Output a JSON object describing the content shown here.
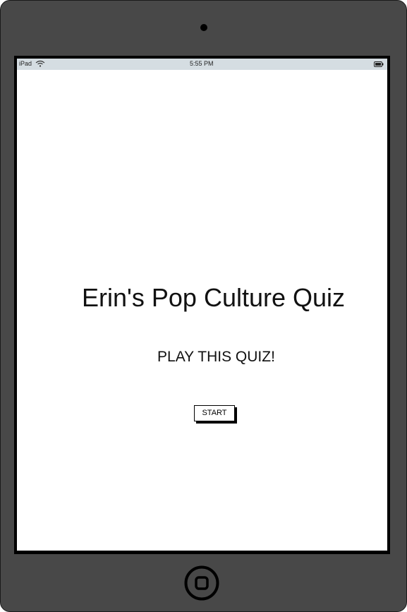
{
  "status_bar": {
    "device": "iPad",
    "time": "5:55 PM",
    "wifi_icon": "wifi-icon",
    "battery_icon": "battery-icon"
  },
  "main": {
    "title": "Erin's Pop Culture Quiz",
    "subtitle": "PLAY THIS QUIZ!",
    "start_label": "START"
  },
  "hardware": {
    "home_icon": "home-button-icon",
    "camera_icon": "camera-icon"
  },
  "colors": {
    "bezel": "#484848",
    "status_bar": "#d5dde2",
    "screen": "#ffffff"
  }
}
